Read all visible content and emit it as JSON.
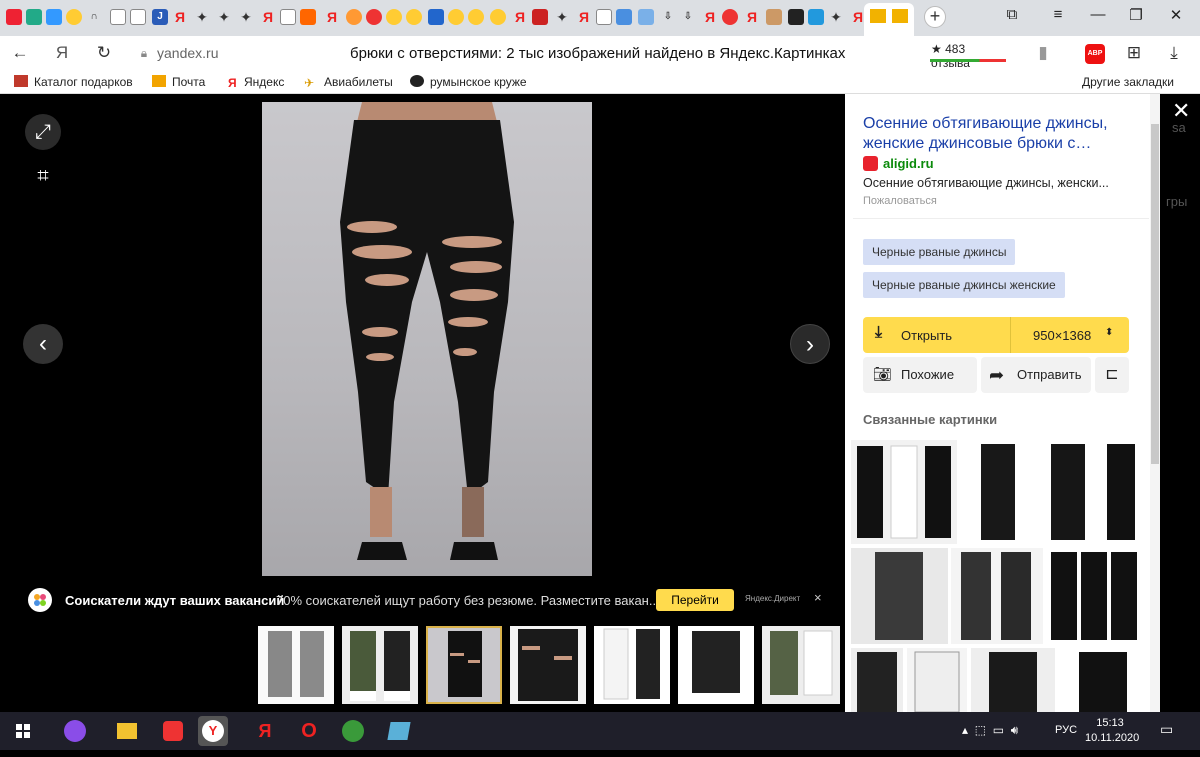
{
  "browser": {
    "url_domain": "yandex.ru",
    "page_title": "брюки с отверстиями: 2 тыс изображений найдено в Яндекс.Картинках",
    "reviews": "★ 483 отзыва",
    "extension_abp": "ABP"
  },
  "bookmarks": [
    {
      "label": "Каталог подарков",
      "icon_color": "#c0392b"
    },
    {
      "label": "Почта",
      "icon_color": "#f2a400"
    },
    {
      "label": "Яндекс",
      "icon_color": "#e22"
    },
    {
      "label": "Авиабилеты",
      "icon_color": "#d99a00"
    },
    {
      "label": "румынское круже",
      "icon_color": "#222"
    }
  ],
  "bookmarks_other": "Другие закладки",
  "viewer": {
    "ad": {
      "bold": "Соискатели ждут ваших вакансий",
      "text": "70% соискателей ищут работу без резюме. Разместите вакан...",
      "button": "Перейти",
      "source": "Яндекс.Директ",
      "close": "×"
    },
    "edge_text_1": "sa",
    "edge_text_2": "гры"
  },
  "panel": {
    "title": "Осенние обтягивающие джинсы, женские джинсовые брюки с…",
    "site": "aligid.ru",
    "description": "Осенние обтягивающие джинсы, женски...",
    "report": "Пожаловаться",
    "tags": [
      "Черные рваные джинсы",
      "Черные рваные джинсы женские"
    ],
    "open_label": "Открыть",
    "size": "950×1368",
    "similar_label": "Похожие",
    "share_label": "Отправить",
    "related_title": "Связанные картинки"
  },
  "taskbar": {
    "lang": "РУС",
    "time": "15:13",
    "date": "10.11.2020"
  },
  "icons": [
    "fullscreen-icon",
    "crop-icon",
    "prev-arrow-icon",
    "next-arrow-icon",
    "download-icon",
    "camera-icon",
    "share-icon",
    "collection-icon",
    "close-icon"
  ],
  "colors": {
    "accent_yellow": "#ffdb4d",
    "link_blue": "#1a3fa8",
    "site_green": "#0b8a0b",
    "tag_bg": "#d5def5"
  }
}
